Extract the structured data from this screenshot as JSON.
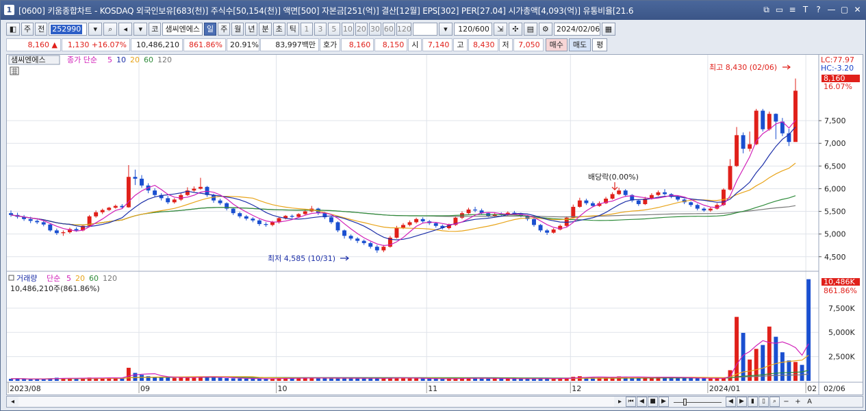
{
  "window": {
    "icon_label": "1",
    "title": "[0600] 키움종합차트 - KOSDAQ 외국인보유[683(천)] 주식수[50,154(천)] 액면[500] 자본금[251(억)] 결산[12월] EPS[302] PER[27.04] 시가총액[4,093(억)] 유통비율[21.6",
    "buttons": [
      "⧉",
      "▭",
      "≡",
      "T",
      "?",
      "—",
      "▢",
      "✕"
    ]
  },
  "toolbar": {
    "mode_label": "주",
    "prev_label": "전",
    "stock_code": "252990",
    "type_label": "코",
    "stock_name": "샘씨엔에스",
    "period_buttons": [
      "일",
      "주",
      "월",
      "년",
      "분",
      "초",
      "틱"
    ],
    "active_period": "일",
    "interval_buttons": [
      "1",
      "3",
      "5",
      "10",
      "20",
      "30",
      "60",
      "120"
    ],
    "count_value": "120/600",
    "date_value": "2024/02/06"
  },
  "pricebar": {
    "price": "8,160 ▲",
    "change": "1,130 +16.07%",
    "volume": "10,486,210",
    "vol_ratio": "861.86%",
    "turnover": "20.91%",
    "amount": "83,997백만",
    "quote_label": "호가",
    "ask": "8,160",
    "bid": "8,150",
    "open_label": "시",
    "open": "7,140",
    "high_label": "고",
    "high": "8,430",
    "low_label": "저",
    "low": "7,050",
    "buy_label": "매수",
    "sell_label": "매도",
    "flat_label": "평"
  },
  "price_panel": {
    "stock_tag": "샘씨엔에스",
    "ma_title": "종가 단순",
    "ma_periods": [
      "5",
      "10",
      "20",
      "60",
      "120"
    ],
    "lc_label": "LC:77.97",
    "hc_label": "HC:-3.20",
    "current_price_tag": "8,160",
    "current_pct_tag": "16.07%",
    "y_ticks": [
      "7,500",
      "7,000",
      "6,500",
      "6,000",
      "5,500",
      "5,000",
      "4,500"
    ],
    "high_annotation": "최고 8,430 (02/06)",
    "low_annotation": "최저 4,585 (10/31)",
    "dividend_annotation": "배당락(0.00%)"
  },
  "volume_panel": {
    "title": "거래량",
    "ma_title": "단순",
    "ma_periods": [
      "5",
      "20",
      "60",
      "120"
    ],
    "current_value_text": "10,486,210주(861.86%)",
    "current_tag": "10,486K",
    "current_pct_tag": "861.86%",
    "y_ticks": [
      "7,500K",
      "5,000K",
      "2,500K"
    ]
  },
  "x_axis": {
    "labels": [
      "2023/08",
      "09",
      "10",
      "11",
      "12",
      "2024/01",
      "02"
    ],
    "end_label": "02/06"
  },
  "colors": {
    "up": "#e0201a",
    "down": "#1a4fd0",
    "ma5": "#d11fb8",
    "ma10": "#1c2fa8",
    "ma20": "#e8a41a",
    "ma60": "#2e8b3a",
    "ma120": "#777777"
  },
  "chart_data": {
    "type": "candlestick",
    "candles": [
      [
        5460,
        5420,
        5520,
        5380
      ],
      [
        5420,
        5380,
        5470,
        5340
      ],
      [
        5380,
        5330,
        5420,
        5290
      ],
      [
        5330,
        5290,
        5380,
        5240
      ],
      [
        5290,
        5260,
        5320,
        5220
      ],
      [
        5260,
        5210,
        5300,
        5170
      ],
      [
        5210,
        5080,
        5230,
        5050
      ],
      [
        5080,
        5020,
        5120,
        4980
      ],
      [
        5020,
        5040,
        5080,
        4960
      ],
      [
        5040,
        5110,
        5140,
        5010
      ],
      [
        5110,
        5080,
        5150,
        5050
      ],
      [
        5080,
        5180,
        5200,
        5060
      ],
      [
        5180,
        5390,
        5420,
        5160
      ],
      [
        5390,
        5480,
        5520,
        5360
      ],
      [
        5480,
        5530,
        5560,
        5440
      ],
      [
        5530,
        5580,
        5600,
        5510
      ],
      [
        5580,
        5620,
        5650,
        5560
      ],
      [
        5620,
        5590,
        5660,
        5560
      ],
      [
        5590,
        6260,
        6520,
        5580
      ],
      [
        6260,
        6220,
        6420,
        6080
      ],
      [
        6220,
        6070,
        6300,
        6020
      ],
      [
        6070,
        5960,
        6120,
        5900
      ],
      [
        5960,
        5860,
        6010,
        5810
      ],
      [
        5860,
        5790,
        5900,
        5740
      ],
      [
        5790,
        5700,
        5840,
        5660
      ],
      [
        5700,
        5760,
        5790,
        5670
      ],
      [
        5760,
        5860,
        5900,
        5730
      ],
      [
        5860,
        5960,
        6030,
        5840
      ],
      [
        5960,
        6000,
        6050,
        5930
      ],
      [
        6000,
        6040,
        6240,
        5980
      ],
      [
        6040,
        5860,
        6060,
        5820
      ],
      [
        5860,
        5740,
        5890,
        5690
      ],
      [
        5740,
        5680,
        5780,
        5640
      ],
      [
        5680,
        5560,
        5700,
        5520
      ],
      [
        5560,
        5460,
        5590,
        5420
      ],
      [
        5460,
        5390,
        5490,
        5350
      ],
      [
        5390,
        5340,
        5420,
        5300
      ],
      [
        5340,
        5300,
        5370,
        5260
      ],
      [
        5300,
        5220,
        5330,
        5180
      ],
      [
        5220,
        5200,
        5260,
        5160
      ],
      [
        5200,
        5260,
        5290,
        5170
      ],
      [
        5260,
        5350,
        5380,
        5230
      ],
      [
        5350,
        5400,
        5420,
        5320
      ],
      [
        5400,
        5380,
        5430,
        5350
      ],
      [
        5380,
        5440,
        5460,
        5360
      ],
      [
        5440,
        5500,
        5550,
        5420
      ],
      [
        5500,
        5560,
        5620,
        5480
      ],
      [
        5560,
        5460,
        5580,
        5420
      ],
      [
        5460,
        5370,
        5490,
        5330
      ],
      [
        5370,
        5260,
        5390,
        5220
      ],
      [
        5260,
        5080,
        5280,
        5040
      ],
      [
        5080,
        4960,
        5100,
        4900
      ],
      [
        4960,
        4900,
        4990,
        4860
      ],
      [
        4900,
        4850,
        4930,
        4800
      ],
      [
        4850,
        4800,
        4880,
        4760
      ],
      [
        4800,
        4720,
        4830,
        4680
      ],
      [
        4720,
        4640,
        4760,
        4585
      ],
      [
        4640,
        4720,
        4760,
        4600
      ],
      [
        4720,
        4920,
        4960,
        4700
      ],
      [
        4920,
        5140,
        5180,
        4900
      ],
      [
        5140,
        5200,
        5240,
        5110
      ],
      [
        5200,
        5260,
        5300,
        5170
      ],
      [
        5260,
        5330,
        5360,
        5230
      ],
      [
        5330,
        5280,
        5370,
        5250
      ],
      [
        5280,
        5240,
        5310,
        5200
      ],
      [
        5240,
        5180,
        5260,
        5140
      ],
      [
        5180,
        5130,
        5210,
        5100
      ],
      [
        5130,
        5200,
        5230,
        5100
      ],
      [
        5200,
        5360,
        5390,
        5180
      ],
      [
        5360,
        5460,
        5500,
        5330
      ],
      [
        5460,
        5540,
        5580,
        5440
      ],
      [
        5540,
        5520,
        5600,
        5480
      ],
      [
        5520,
        5460,
        5560,
        5430
      ],
      [
        5460,
        5400,
        5480,
        5370
      ],
      [
        5400,
        5440,
        5470,
        5370
      ],
      [
        5440,
        5420,
        5480,
        5390
      ],
      [
        5420,
        5470,
        5500,
        5400
      ],
      [
        5470,
        5440,
        5510,
        5410
      ],
      [
        5440,
        5400,
        5470,
        5370
      ],
      [
        5400,
        5330,
        5420,
        5290
      ],
      [
        5330,
        5200,
        5350,
        5160
      ],
      [
        5200,
        5080,
        5220,
        5040
      ],
      [
        5080,
        5030,
        5110,
        4980
      ],
      [
        5030,
        5100,
        5130,
        5010
      ],
      [
        5100,
        5180,
        5210,
        5080
      ],
      [
        5180,
        5360,
        5390,
        5160
      ],
      [
        5360,
        5600,
        5650,
        5340
      ],
      [
        5600,
        5740,
        5800,
        5580
      ],
      [
        5740,
        5680,
        5780,
        5640
      ],
      [
        5680,
        5620,
        5720,
        5590
      ],
      [
        5620,
        5680,
        5720,
        5600
      ],
      [
        5680,
        5780,
        5820,
        5660
      ],
      [
        5780,
        5880,
        5920,
        5760
      ],
      [
        5880,
        5960,
        6020,
        5860
      ],
      [
        5960,
        5860,
        5990,
        5820
      ],
      [
        5860,
        5740,
        5880,
        5700
      ],
      [
        5740,
        5660,
        5760,
        5620
      ],
      [
        5660,
        5780,
        5820,
        5640
      ],
      [
        5780,
        5860,
        5900,
        5760
      ],
      [
        5860,
        5920,
        5960,
        5840
      ],
      [
        5920,
        5880,
        5990,
        5850
      ],
      [
        5880,
        5820,
        5900,
        5790
      ],
      [
        5820,
        5760,
        5850,
        5720
      ],
      [
        5760,
        5700,
        5780,
        5660
      ],
      [
        5700,
        5640,
        5720,
        5600
      ],
      [
        5640,
        5560,
        5670,
        5520
      ],
      [
        5560,
        5520,
        5590,
        5490
      ],
      [
        5520,
        5560,
        5590,
        5490
      ],
      [
        5560,
        5640,
        5680,
        5540
      ],
      [
        5640,
        5980,
        6010,
        5620
      ],
      [
        5980,
        6500,
        6650,
        5960
      ],
      [
        6500,
        7180,
        7360,
        6480
      ],
      [
        7180,
        6880,
        7240,
        6780
      ],
      [
        6880,
        6980,
        7260,
        6820
      ],
      [
        6980,
        7720,
        7760,
        6960
      ],
      [
        7720,
        7310,
        7760,
        7260
      ],
      [
        7310,
        7650,
        7700,
        7280
      ],
      [
        7650,
        7480,
        7660,
        7090
      ],
      [
        7480,
        7220,
        7560,
        7160
      ],
      [
        7220,
        7030,
        7320,
        6940
      ],
      [
        7030,
        8160,
        8430,
        7050
      ]
    ],
    "volume_k": [
      210,
      240,
      180,
      160,
      190,
      230,
      260,
      320,
      280,
      250,
      230,
      300,
      340,
      320,
      280,
      300,
      330,
      290,
      1350,
      820,
      620,
      480,
      410,
      360,
      330,
      300,
      340,
      380,
      390,
      450,
      420,
      350,
      310,
      280,
      260,
      240,
      230,
      220,
      210,
      200,
      240,
      280,
      300,
      260,
      270,
      310,
      330,
      300,
      280,
      260,
      290,
      320,
      280,
      260,
      240,
      250,
      300,
      270,
      310,
      350,
      280,
      260,
      250,
      240,
      220,
      210,
      200,
      220,
      260,
      300,
      310,
      280,
      260,
      240,
      230,
      220,
      240,
      230,
      210,
      220,
      240,
      260,
      230,
      220,
      240,
      310,
      420,
      480,
      380,
      350,
      340,
      380,
      420,
      460,
      400,
      360,
      340,
      380,
      390,
      420,
      380,
      340,
      320,
      300,
      280,
      260,
      250,
      240,
      260,
      300,
      1100,
      6600,
      4950,
      2200,
      3300,
      3700,
      5600,
      4550,
      2950,
      2100,
      1950,
      1650,
      10486
    ]
  }
}
